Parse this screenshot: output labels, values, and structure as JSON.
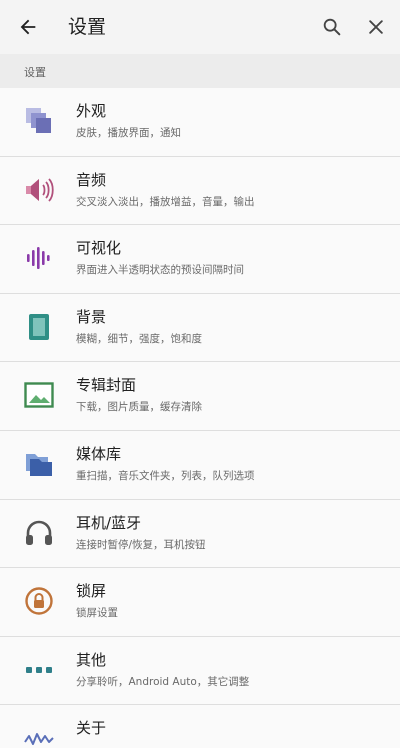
{
  "appbar": {
    "title": "设置"
  },
  "section": {
    "title": "设置"
  },
  "items": [
    {
      "label": "外观",
      "sub": "皮肤，播放界面，通知",
      "icon": "layers-icon",
      "color": "#6b6fb5"
    },
    {
      "label": "音频",
      "sub": "交叉淡入淡出，播放增益，音量，输出",
      "icon": "speaker-icon",
      "color": "#b1507b"
    },
    {
      "label": "可视化",
      "sub": "界面进入半透明状态的预设间隔时间",
      "icon": "equalizer-icon",
      "color": "#8a3aa9"
    },
    {
      "label": "背景",
      "sub": "模糊，细节，强度，饱和度",
      "icon": "background-icon",
      "color": "#2f8f86"
    },
    {
      "label": "专辑封面",
      "sub": "下载，图片质量，缓存清除",
      "icon": "image-icon",
      "color": "#3f8a50"
    },
    {
      "label": "媒体库",
      "sub": "重扫描，音乐文件夹，列表，队列选项",
      "icon": "folder-icon",
      "color": "#3b5fa8"
    },
    {
      "label": "耳机/蓝牙",
      "sub": "连接时暂停/恢复，耳机按钮",
      "icon": "headphones-icon",
      "color": "#555555"
    },
    {
      "label": "锁屏",
      "sub": "锁屏设置",
      "icon": "lock-icon",
      "color": "#c0743a"
    },
    {
      "label": "其他",
      "sub": "分享聆听，Android Auto，其它调整",
      "icon": "more-icon",
      "color": "#2f7f8a"
    },
    {
      "label": "关于",
      "sub": "",
      "icon": "waveform-icon",
      "color": "#5a6fb8"
    }
  ]
}
